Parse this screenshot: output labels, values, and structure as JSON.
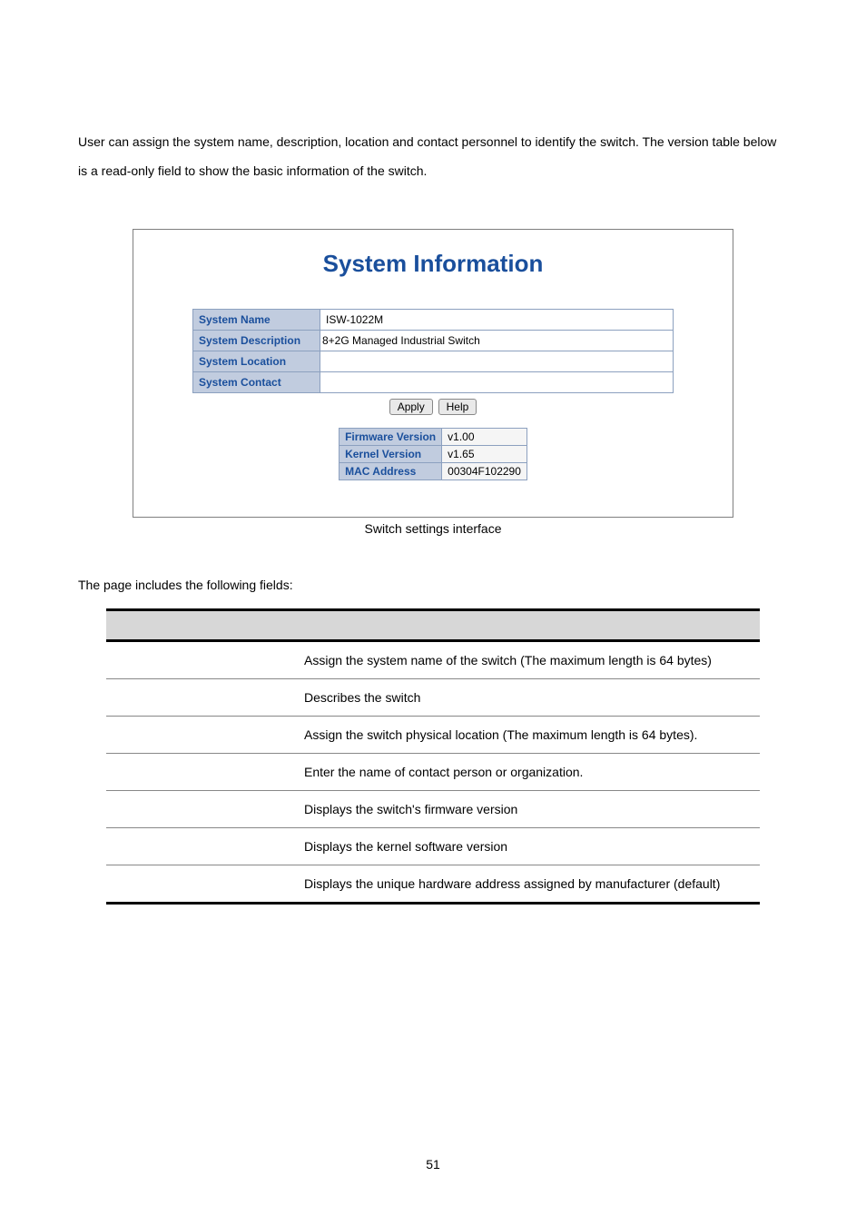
{
  "intro": "User can assign the system name, description, location and contact personnel to identify the switch. The version table below is a read-only field to show the basic information of the switch.",
  "screenshot": {
    "title": "System Information",
    "form": {
      "rows": [
        {
          "label": "System Name",
          "hasInput": true,
          "value": "ISW-1022M"
        },
        {
          "label": "System Description",
          "hasInput": false,
          "value": "8+2G Managed Industrial Switch"
        },
        {
          "label": "System Location",
          "hasInput": true,
          "value": ""
        },
        {
          "label": "System Contact",
          "hasInput": true,
          "value": ""
        }
      ]
    },
    "buttons": {
      "apply": "Apply",
      "help": "Help"
    },
    "version": {
      "rows": [
        {
          "label": "Firmware Version",
          "value": "v1.00"
        },
        {
          "label": "Kernel Version",
          "value": "v1.65"
        },
        {
          "label": "MAC Address",
          "value": "00304F102290"
        }
      ]
    }
  },
  "caption": "Switch settings interface",
  "fieldsIntro": "The page includes the following fields:",
  "fieldsTable": {
    "headers": [
      "",
      ""
    ],
    "rows": [
      {
        "desc": "Assign the system name of the switch (The maximum length is 64 bytes)"
      },
      {
        "desc": "Describes the switch"
      },
      {
        "desc": "Assign the switch physical location (The maximum length is 64 bytes)."
      },
      {
        "desc": "Enter the name of contact person or organization."
      },
      {
        "desc": "Displays the switch's firmware version"
      },
      {
        "desc": "Displays the kernel software version"
      },
      {
        "desc": "Displays the unique hardware address assigned by manufacturer (default)"
      }
    ]
  },
  "pageNumber": "51"
}
